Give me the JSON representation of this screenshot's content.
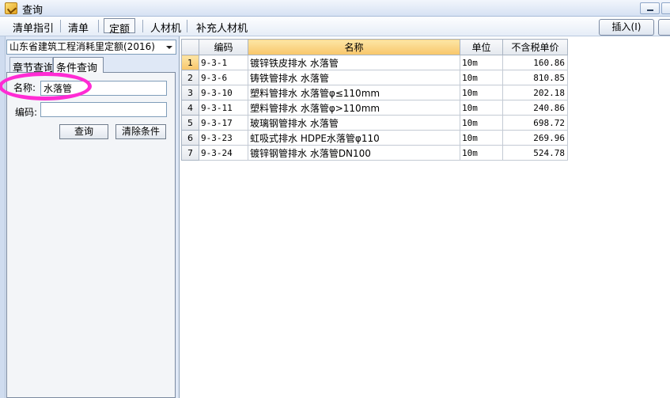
{
  "window": {
    "title": "查询"
  },
  "toolbar": {
    "tabs": [
      "清单指引",
      "清单",
      "定额",
      "人材机",
      "补充人材机"
    ],
    "active_tab": "定额",
    "insert_label": "插入(I)"
  },
  "left": {
    "quota_library": "山东省建筑工程消耗里定额(2016)",
    "tabs": [
      "章节查询",
      "条件查询"
    ],
    "active_tab": "条件查询",
    "name_label": "名称:",
    "name_value": "水落管",
    "code_label": "编码:",
    "code_value": "",
    "query_label": "查询",
    "clear_label": "清除条件"
  },
  "grid": {
    "columns": [
      "",
      "编码",
      "名称",
      "单位",
      "不含税单价"
    ],
    "selected_row": 1,
    "rows": [
      {
        "idx": "1",
        "code": "9-3-1",
        "name": "镀锌铁皮排水 水落管",
        "unit": "10m",
        "price": "160.86"
      },
      {
        "idx": "2",
        "code": "9-3-6",
        "name": "铸铁管排水 水落管",
        "unit": "10m",
        "price": "810.85"
      },
      {
        "idx": "3",
        "code": "9-3-10",
        "name": "塑料管排水 水落管φ≤110mm",
        "unit": "10m",
        "price": "202.18"
      },
      {
        "idx": "4",
        "code": "9-3-11",
        "name": "塑料管排水 水落管φ>110mm",
        "unit": "10m",
        "price": "240.86"
      },
      {
        "idx": "5",
        "code": "9-3-17",
        "name": "玻璃钢管排水 水落管",
        "unit": "10m",
        "price": "698.72"
      },
      {
        "idx": "6",
        "code": "9-3-23",
        "name": "虹吸式排水 HDPE水落管φ110",
        "unit": "10m",
        "price": "269.96"
      },
      {
        "idx": "7",
        "code": "9-3-24",
        "name": "镀锌钢管排水 水落管DN100",
        "unit": "10m",
        "price": "524.78"
      }
    ]
  },
  "colors": {
    "highlight_ring": "#ff2bd4",
    "selected_header": "#f8c66a"
  }
}
